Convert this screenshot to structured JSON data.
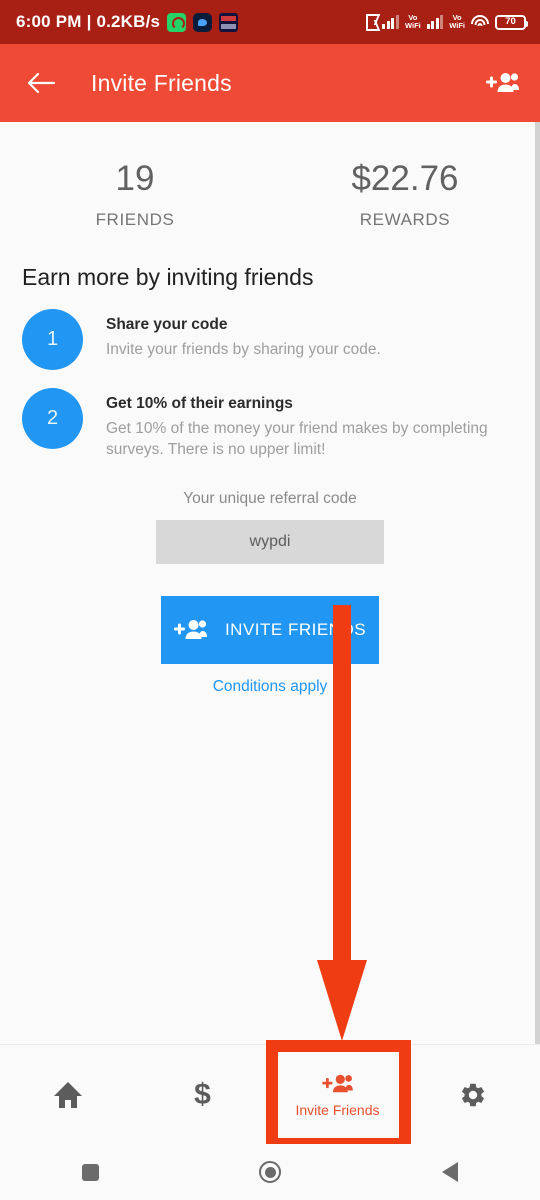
{
  "status_bar": {
    "clock_and_net": "6:00 PM | 0.2KB/s",
    "app_icons": [
      "whatsapp-icon",
      "messenger-icon",
      "times-of-india-icon"
    ],
    "bluetooth": "bluetooth-icon",
    "sim1_label": "Vo\nWiFi",
    "sim1_line1": "Vo",
    "sim1_line2": "WiFi",
    "sim2_line1": "Vo",
    "sim2_line2": "WiFi",
    "wifi": "wifi-icon",
    "battery_level": "70"
  },
  "app_bar": {
    "title": "Invite Friends",
    "back_icon": "back-arrow-icon",
    "action_icon": "person-add-icon",
    "background_color": "#ef4a35"
  },
  "stats": [
    {
      "value": "19",
      "label": "FRIENDS"
    },
    {
      "value": "$22.76",
      "label": "REWARDS"
    }
  ],
  "earn_section": {
    "title": "Earn more by inviting friends",
    "steps": [
      {
        "number": "1",
        "title": "Share your code",
        "description": "Invite your friends by sharing your code."
      },
      {
        "number": "2",
        "title": "Get 10% of their earnings",
        "description": "Get 10% of the money your friend makes by completing surveys. There is no upper limit!"
      }
    ]
  },
  "referral": {
    "label": "Your unique referral code",
    "code": "wypdi",
    "button_label": "INVITE FRIENDS",
    "button_icon": "person-add-icon",
    "button_color": "#2196f3",
    "conditions_link": "Conditions apply"
  },
  "bottom_nav": {
    "items": [
      {
        "label": "",
        "icon": "home-icon",
        "active": false
      },
      {
        "label": "",
        "icon": "dollar-icon",
        "active": false
      },
      {
        "label": "Invite Friends",
        "icon": "person-add-icon",
        "active": true
      },
      {
        "label": "",
        "icon": "gear-icon",
        "active": false
      }
    ]
  },
  "annotations": {
    "arrow_color": "#f03c12",
    "highlight_box_color": "#f03c12"
  },
  "android_nav": {
    "recents": "square-recents-icon",
    "home": "circle-home-icon",
    "back": "triangle-back-icon"
  }
}
